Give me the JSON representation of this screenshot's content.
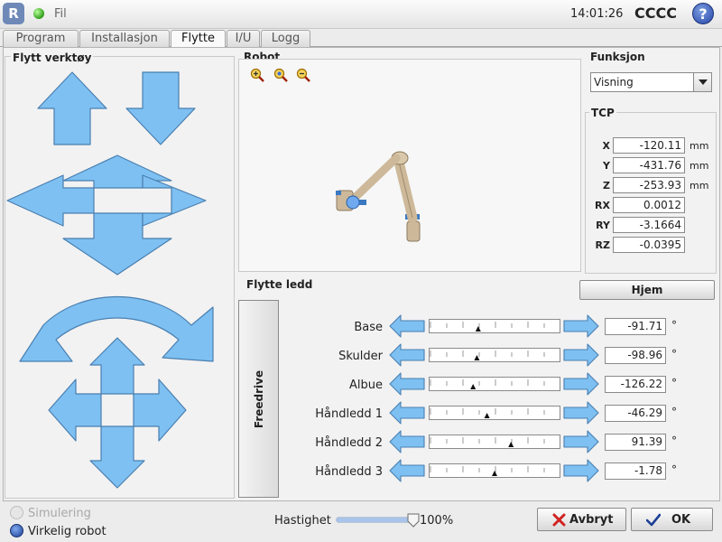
{
  "topbar": {
    "logo_text": "R",
    "file_label": "Fil",
    "time": "14:01:26",
    "robot_name": "CCCC",
    "help_symbol": "?"
  },
  "tabs": [
    {
      "label": "Program",
      "active": false
    },
    {
      "label": "Installasjon",
      "active": false
    },
    {
      "label": "Flytte",
      "active": true
    },
    {
      "label": "I/U",
      "active": false
    },
    {
      "label": "Logg",
      "active": false
    }
  ],
  "tool_panel": {
    "title": "Flytt verktøy"
  },
  "robot_panel": {
    "title": "Robot",
    "zoom_icons": [
      "zoom-in-icon",
      "zoom-reset-icon",
      "zoom-out-icon"
    ]
  },
  "function_panel": {
    "title": "Funksjon",
    "selected": "Visning"
  },
  "tcp": {
    "title": "TCP",
    "rows": [
      {
        "label": "X",
        "value": "-120.11",
        "unit": "mm"
      },
      {
        "label": "Y",
        "value": "-431.76",
        "unit": "mm"
      },
      {
        "label": "Z",
        "value": "-253.93",
        "unit": "mm"
      },
      {
        "label": "RX",
        "value": "0.0012",
        "unit": ""
      },
      {
        "label": "RY",
        "value": "-3.1664",
        "unit": ""
      },
      {
        "label": "RZ",
        "value": "-0.0395",
        "unit": ""
      }
    ]
  },
  "joints": {
    "title": "Flytte ledd",
    "home_label": "Hjem",
    "freedrive_label": "Freedrive",
    "unit": "°",
    "rows": [
      {
        "label": "Base",
        "value": "-91.71",
        "slider_fraction": 0.37
      },
      {
        "label": "Skulder",
        "value": "-98.96",
        "slider_fraction": 0.36
      },
      {
        "label": "Albue",
        "value": "-126.22",
        "slider_fraction": 0.33
      },
      {
        "label": "Håndledd 1",
        "value": "-46.29",
        "slider_fraction": 0.44
      },
      {
        "label": "Håndledd 2",
        "value": "91.39",
        "slider_fraction": 0.63
      },
      {
        "label": "Håndledd 3",
        "value": "-1.78",
        "slider_fraction": 0.5
      }
    ]
  },
  "bottom": {
    "simulation_label": "Simulering",
    "real_robot_label": "Virkelig robot",
    "speed_label": "Hastighet",
    "speed_value": "100%",
    "speed_fraction": 1.0,
    "cancel_label": "Avbryt",
    "ok_label": "OK"
  },
  "colors": {
    "arrow_fill": "#7ec0f2",
    "arrow_stroke": "#4a7fb0",
    "accent_blue": "#2446a8",
    "status_green": "#2f9c1a"
  }
}
